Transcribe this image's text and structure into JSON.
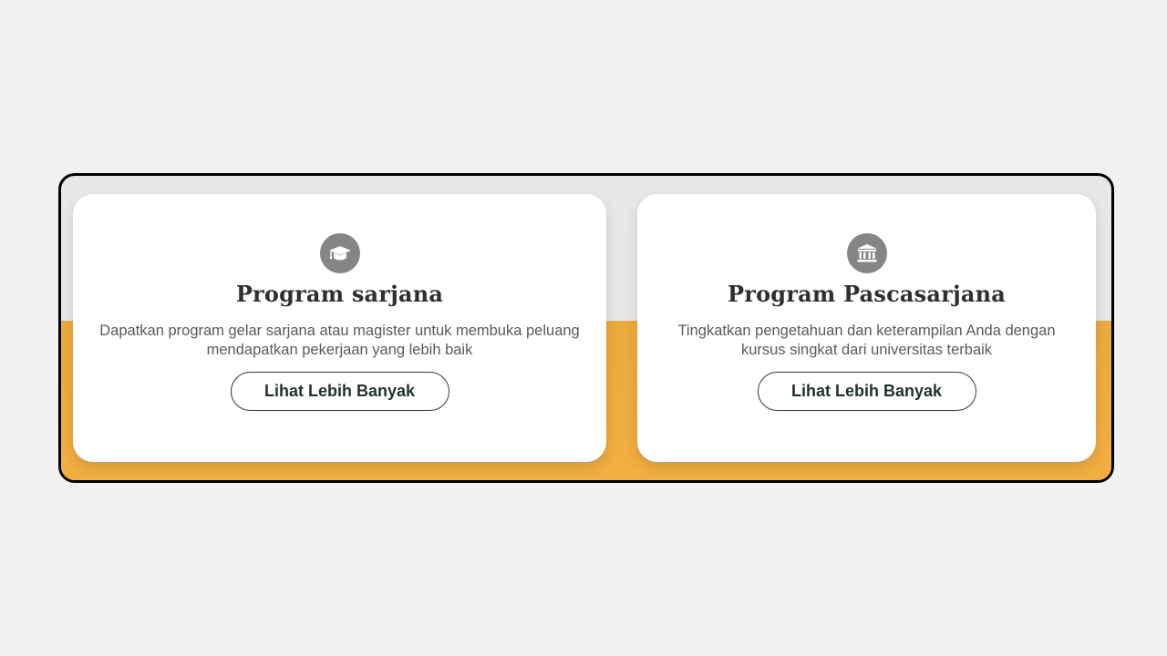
{
  "cards": [
    {
      "icon": "graduation-cap-icon",
      "title": "Program sarjana",
      "description": "Dapatkan program gelar sarjana atau magister untuk membuka peluang mendapatkan pekerjaan yang lebih baik",
      "button_label": "Lihat Lebih Banyak"
    },
    {
      "icon": "university-building-icon",
      "title": "Program Pascasarjana",
      "description": "Tingkatkan pengetahuan dan keterampilan Anda dengan kursus singkat dari universitas terbaik",
      "button_label": "Lihat Lebih Banyak"
    }
  ],
  "colors": {
    "background": "#f1f1f1",
    "band": "#f0ac40",
    "icon_circle": "#858585",
    "title": "#2f2f2f",
    "button_text": "#1f3328"
  }
}
